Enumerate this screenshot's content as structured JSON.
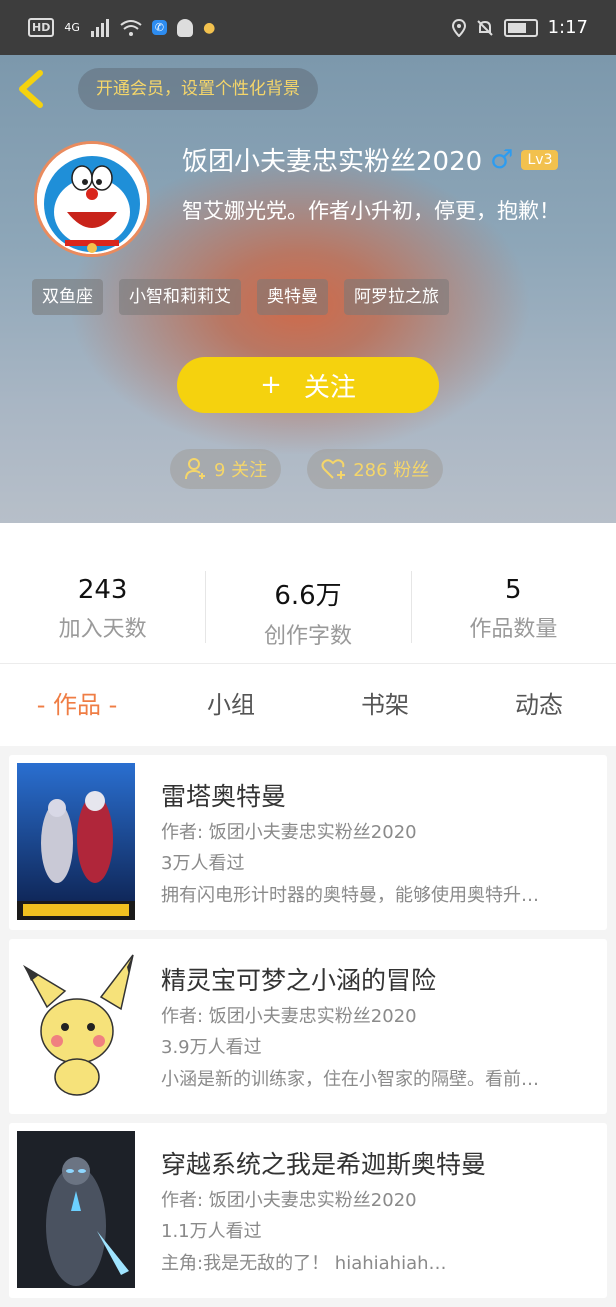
{
  "status_bar": {
    "hd_label": "HD",
    "network_label": "4G",
    "time": "1:17",
    "icons": [
      "signal-icon",
      "wifi-icon",
      "qq-icon",
      "location-icon",
      "mute-icon",
      "battery-icon"
    ]
  },
  "header": {
    "vip_banner": "开通会员，设置个性化背景",
    "username": "饭团小夫妻忠实粉丝2020",
    "gender_symbol": "♂",
    "level": "Lv3",
    "bio": "智艾娜光党。作者小升初，停更，抱歉！",
    "tags": [
      "双鱼座",
      "小智和莉莉艾",
      "奥特曼",
      "阿罗拉之旅"
    ],
    "follow_plus": "+",
    "follow_label": "关注",
    "following_count": "9 关注",
    "fans_count": "286 粉丝",
    "colors": {
      "accent_yellow": "#f5d20e",
      "vip_text": "#f5d66a"
    }
  },
  "stats": [
    {
      "value": "243",
      "label": "加入天数"
    },
    {
      "value": "6.6万",
      "label": "创作字数"
    },
    {
      "value": "5",
      "label": "作品数量"
    }
  ],
  "tabs": [
    {
      "label": "- 作品 -",
      "active": true
    },
    {
      "label": "小组",
      "active": false
    },
    {
      "label": "书架",
      "active": false
    },
    {
      "label": "动态",
      "active": false
    }
  ],
  "works": [
    {
      "title": "雷塔奥特曼",
      "author": "作者: 饭团小夫妻忠实粉丝2020",
      "views": "3万人看过",
      "description": "拥有闪电形计时器的奥特曼，能够使用奥特升…"
    },
    {
      "title": "精灵宝可梦之小涵的冒险",
      "author": "作者: 饭团小夫妻忠实粉丝2020",
      "views": "3.9万人看过",
      "description": "小涵是新的训练家，住在小智家的隔壁。看前…"
    },
    {
      "title": "穿越系统之我是希迦斯奥特曼",
      "author": "作者: 饭团小夫妻忠实粉丝2020",
      "views": "1.1万人看过",
      "description": "主角:我是无敌的了！ hiahiahiah…"
    }
  ]
}
